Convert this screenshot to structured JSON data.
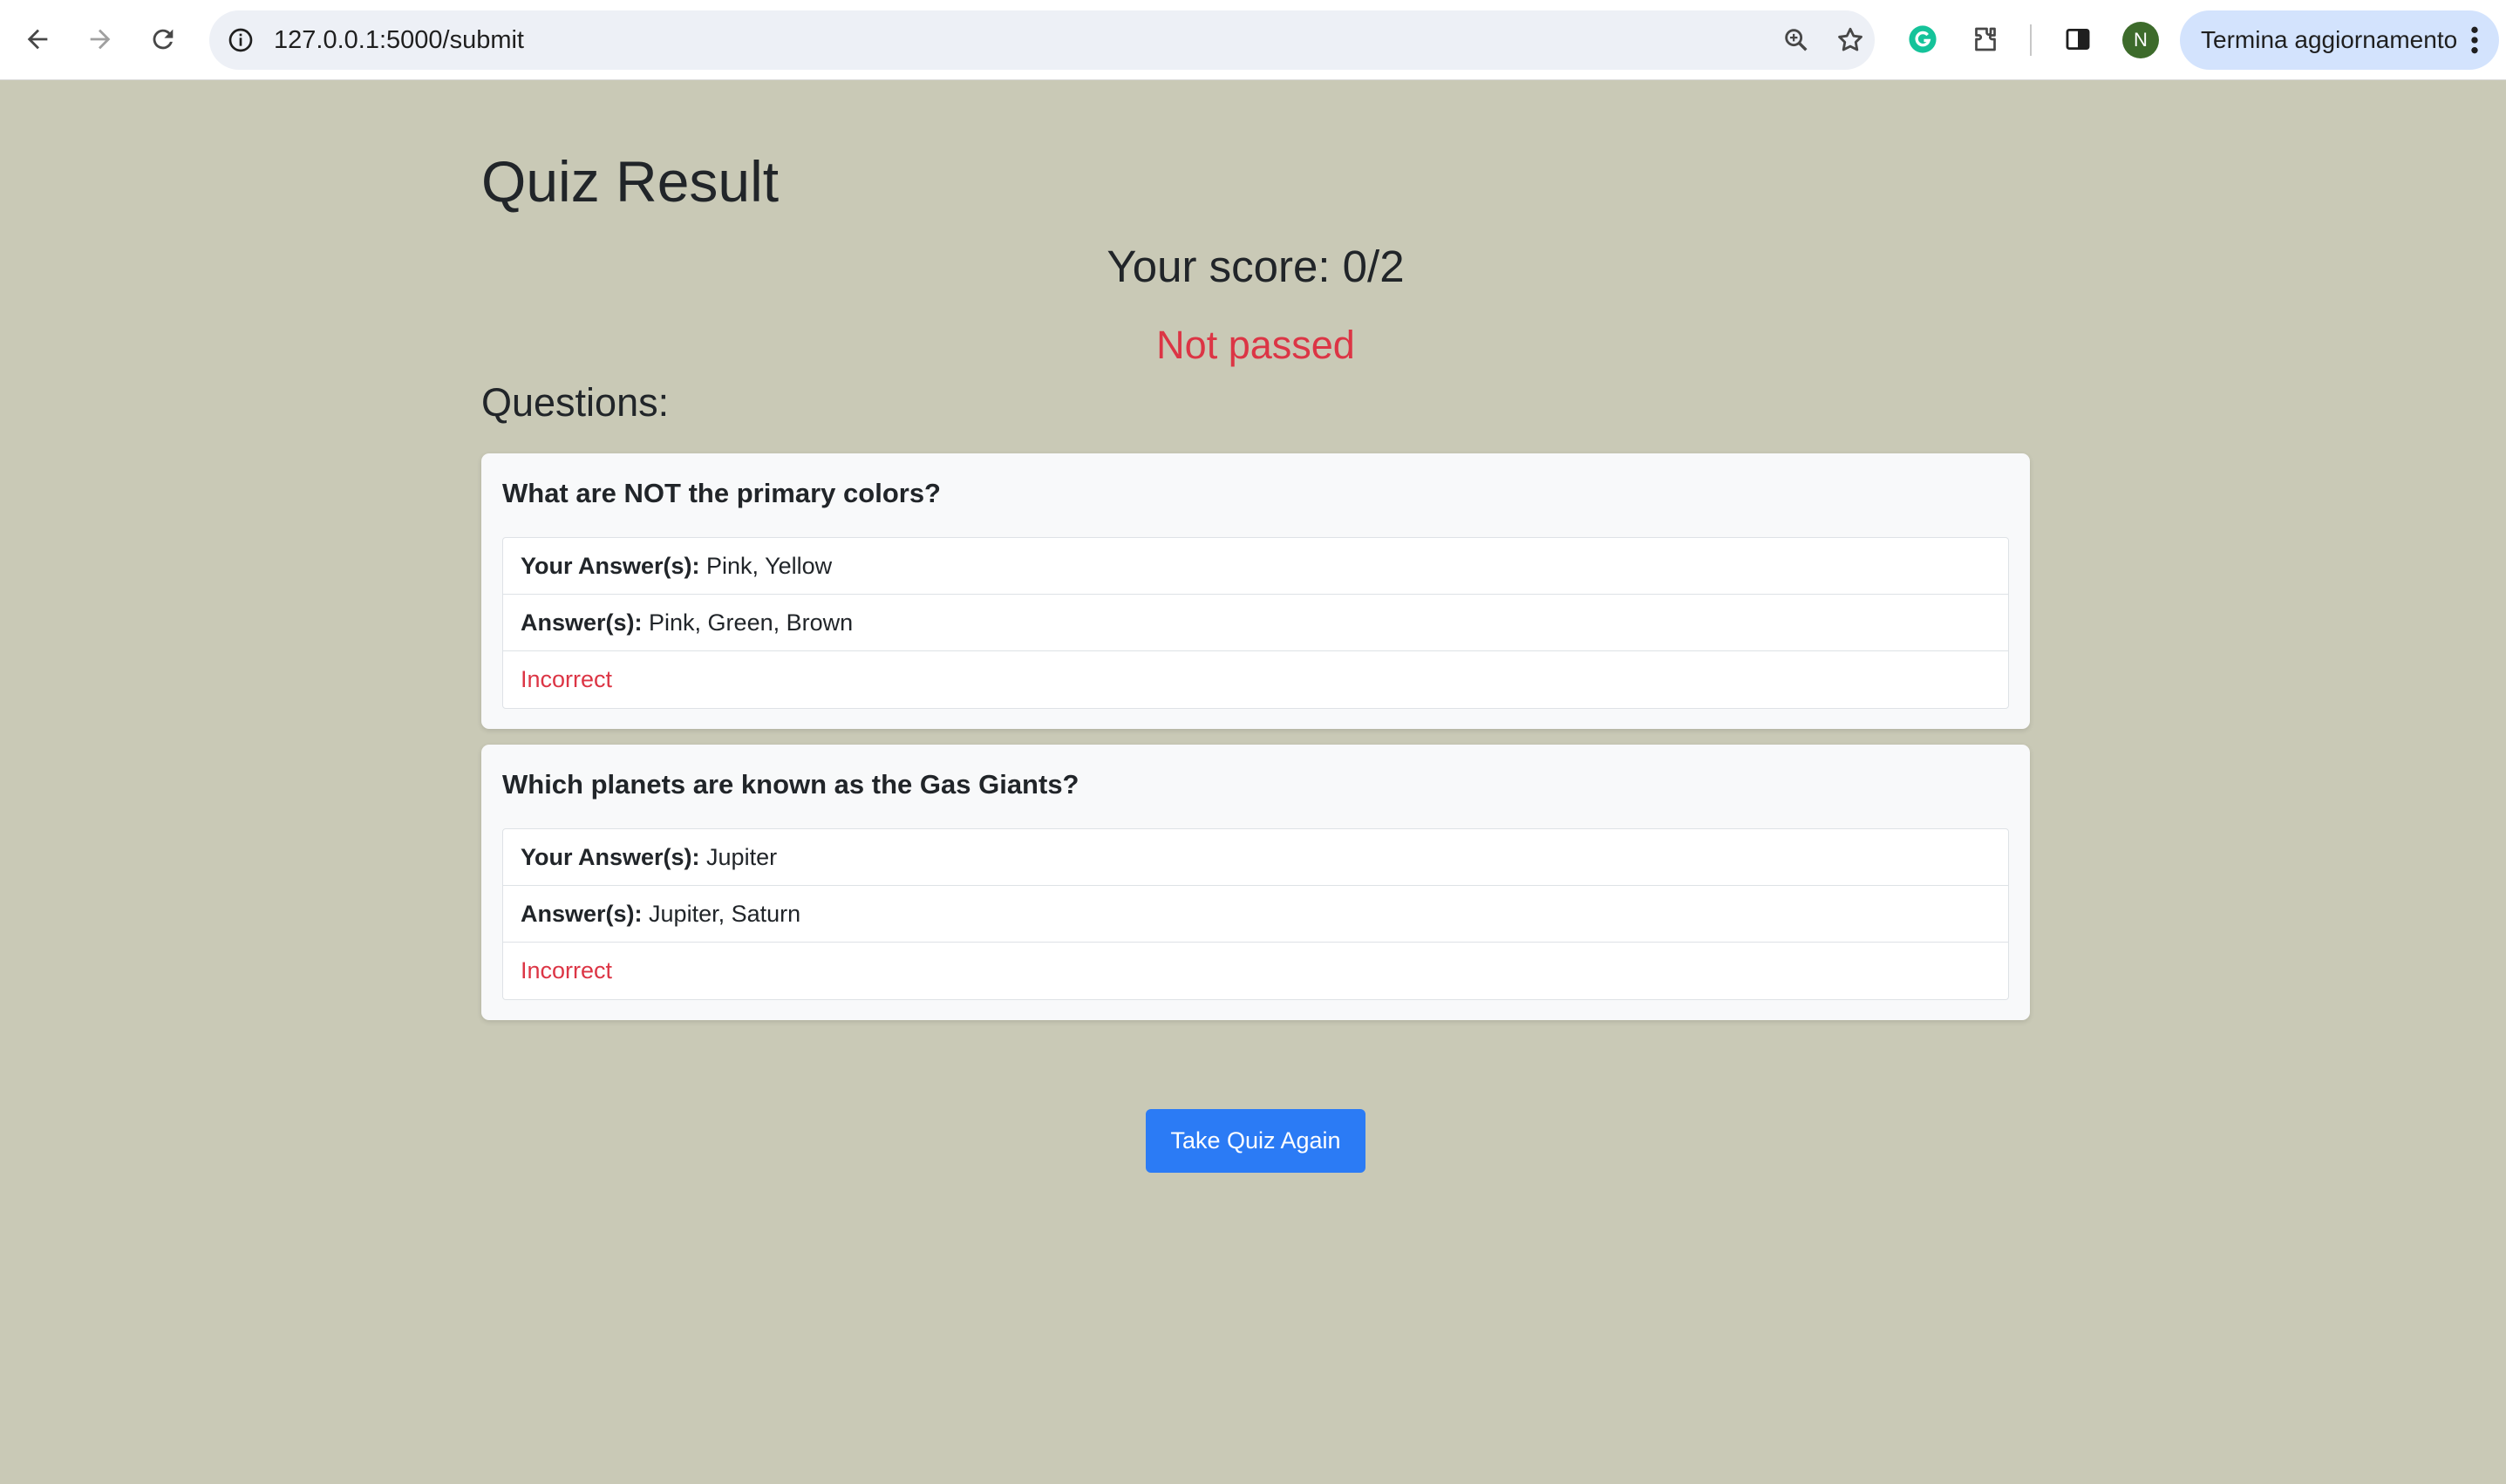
{
  "browser": {
    "url": "127.0.0.1:5000/submit",
    "profile_initial": "N",
    "update_label": "Termina aggiornamento",
    "icons": [
      "back-icon",
      "forward-icon",
      "reload-icon",
      "site-info-icon",
      "zoom-icon",
      "bookmark-star-icon",
      "grammarly-icon",
      "extensions-icon",
      "side-panel-icon",
      "more-vert-icon"
    ]
  },
  "page": {
    "title": "Quiz Result",
    "score": "Your score: 0/2",
    "status": "Not passed",
    "questions_heading": "Questions:"
  },
  "questions": [
    {
      "question": "What are NOT the primary colors?",
      "your_label": "Your Answer(s):",
      "your_answer": " Pink, Yellow",
      "answer_label": "Answer(s):",
      "answer": " Pink, Green, Brown",
      "result": "Incorrect"
    },
    {
      "question": "Which planets are known as the Gas Giants?",
      "your_label": "Your Answer(s):",
      "your_answer": " Jupiter",
      "answer_label": "Answer(s):",
      "answer": " Jupiter, Saturn",
      "result": "Incorrect"
    }
  ],
  "actions": {
    "retake_label": "Take Quiz Again"
  },
  "colors": {
    "background": "#c9c9b6",
    "danger": "#dc3545",
    "primary": "#2b7bf5",
    "card": "#f8f9fa"
  }
}
